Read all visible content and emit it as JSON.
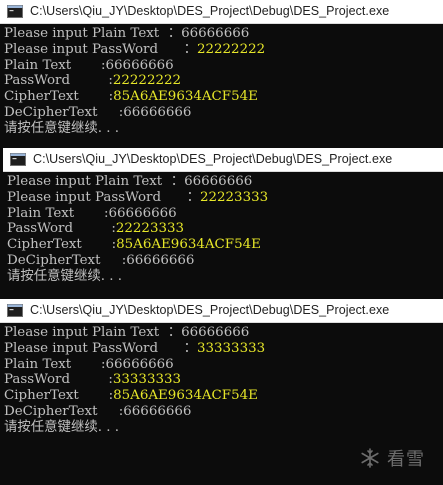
{
  "windows": [
    {
      "title": "C:\\Users\\Qiu_JY\\Desktop\\DES_Project\\Debug\\DES_Project.exe",
      "lines": [
        {
          "label": "Please input Plain Text",
          "sep": "  ：",
          "value": "66666666",
          "value_color": "gray"
        },
        {
          "label": "Please input PassWord",
          "sep": "      ：",
          "value": "22222222",
          "value_color": "yellow"
        },
        {
          "label": "Plain Text",
          "sep": "       :",
          "value": "66666666",
          "value_color": "gray"
        },
        {
          "label": "PassWord",
          "sep": "         :",
          "value": "22222222",
          "value_color": "yellow"
        },
        {
          "label": "CipherText",
          "sep": "       :",
          "value": "85A6AE9634ACF54E",
          "value_color": "yellow"
        },
        {
          "label": "DeCipherText",
          "sep": "     :",
          "value": "66666666",
          "value_color": "gray"
        },
        {
          "label": "请按任意键继续. . .",
          "sep": "",
          "value": "",
          "value_color": "gray"
        }
      ]
    },
    {
      "title": "C:\\Users\\Qiu_JY\\Desktop\\DES_Project\\Debug\\DES_Project.exe",
      "lines": [
        {
          "label": "Please input Plain Text",
          "sep": "  ：",
          "value": "66666666",
          "value_color": "gray"
        },
        {
          "label": "Please input PassWord",
          "sep": "      ：",
          "value": "22223333",
          "value_color": "yellow"
        },
        {
          "label": "Plain Text",
          "sep": "       :",
          "value": "66666666",
          "value_color": "gray"
        },
        {
          "label": "PassWord",
          "sep": "         :",
          "value": "22223333",
          "value_color": "yellow"
        },
        {
          "label": "CipherText",
          "sep": "       :",
          "value": "85A6AE9634ACF54E",
          "value_color": "yellow"
        },
        {
          "label": "DeCipherText",
          "sep": "     :",
          "value": "66666666",
          "value_color": "gray"
        },
        {
          "label": "请按任意键继续. . .",
          "sep": "",
          "value": "",
          "value_color": "gray"
        }
      ]
    },
    {
      "title": "C:\\Users\\Qiu_JY\\Desktop\\DES_Project\\Debug\\DES_Project.exe",
      "lines": [
        {
          "label": "Please input Plain Text",
          "sep": "  ：",
          "value": "66666666",
          "value_color": "gray"
        },
        {
          "label": "Please input PassWord",
          "sep": "      ：",
          "value": "33333333",
          "value_color": "yellow"
        },
        {
          "label": "Plain Text",
          "sep": "       :",
          "value": "66666666",
          "value_color": "gray"
        },
        {
          "label": "PassWord",
          "sep": "         :",
          "value": "33333333",
          "value_color": "yellow"
        },
        {
          "label": "CipherText",
          "sep": "       :",
          "value": "85A6AE9634ACF54E",
          "value_color": "yellow"
        },
        {
          "label": "DeCipherText",
          "sep": "     :",
          "value": "66666666",
          "value_color": "gray"
        },
        {
          "label": "请按任意键继续. . .",
          "sep": "",
          "value": "",
          "value_color": "gray"
        }
      ]
    }
  ],
  "watermark": {
    "text": "看雪",
    "icon": "snowflake-icon"
  },
  "colors": {
    "console_bg": "#0c0c0c",
    "console_text": "#c0c0c0",
    "console_yellow": "#e6e629",
    "titlebar_bg": "#ffffff"
  }
}
